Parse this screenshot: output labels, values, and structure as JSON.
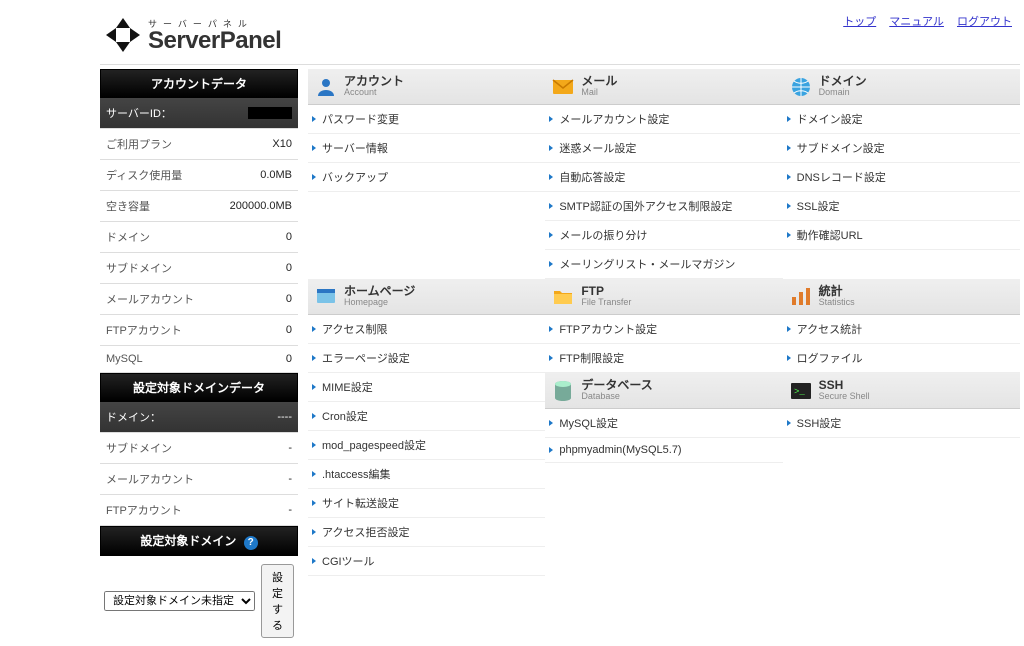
{
  "header": {
    "kana": "サーバーパネル",
    "title": "ServerPanel",
    "links": {
      "top": "トップ",
      "manual": "マニュアル",
      "logout": "ログアウト"
    }
  },
  "sidebar": {
    "accountTitle": "アカウントデータ",
    "serverIdLabel": "サーバーID：",
    "plan": {
      "label": "ご利用プラン",
      "value": "X10"
    },
    "disk": {
      "label": "ディスク使用量",
      "value": "0.0MB"
    },
    "free": {
      "label": "空き容量",
      "value": "200000.0MB"
    },
    "domainCnt": {
      "label": "ドメイン",
      "value": "0"
    },
    "subCnt": {
      "label": "サブドメイン",
      "value": "0"
    },
    "mailCnt": {
      "label": "メールアカウント",
      "value": "0"
    },
    "ftpCnt": {
      "label": "FTPアカウント",
      "value": "0"
    },
    "mysqlCnt": {
      "label": "MySQL",
      "value": "0"
    },
    "targetTitle": "設定対象ドメインデータ",
    "targetDomain": {
      "label": "ドメイン：",
      "value": "----"
    },
    "tSub": {
      "label": "サブドメイン",
      "value": "-"
    },
    "tMail": {
      "label": "メールアカウント",
      "value": "-"
    },
    "tFtp": {
      "label": "FTPアカウント",
      "value": "-"
    },
    "selectTitle": "設定対象ドメイン",
    "selectOption": "設定対象ドメイン未指定",
    "selectBtn": "設定する"
  },
  "categories": {
    "account": {
      "title": "アカウント",
      "sub": "Account",
      "items": [
        "パスワード変更",
        "サーバー情報",
        "バックアップ"
      ]
    },
    "mail": {
      "title": "メール",
      "sub": "Mail",
      "items": [
        "メールアカウント設定",
        "迷惑メール設定",
        "自動応答設定",
        "SMTP認証の国外アクセス制限設定",
        "メールの振り分け",
        "メーリングリスト・メールマガジン"
      ]
    },
    "domain": {
      "title": "ドメイン",
      "sub": "Domain",
      "items": [
        "ドメイン設定",
        "サブドメイン設定",
        "DNSレコード設定",
        "SSL設定",
        "動作確認URL"
      ]
    },
    "homepage": {
      "title": "ホームページ",
      "sub": "Homepage",
      "items": [
        "アクセス制限",
        "エラーページ設定",
        "MIME設定",
        "Cron設定",
        "mod_pagespeed設定",
        ".htaccess編集",
        "サイト転送設定",
        "アクセス拒否設定",
        "CGIツール"
      ]
    },
    "ftp": {
      "title": "FTP",
      "sub": "File Transfer",
      "items": [
        "FTPアカウント設定",
        "FTP制限設定"
      ]
    },
    "stats": {
      "title": "統計",
      "sub": "Statistics",
      "items": [
        "アクセス統計",
        "ログファイル"
      ]
    },
    "db": {
      "title": "データベース",
      "sub": "Database",
      "items": [
        "MySQL設定",
        "phpmyadmin(MySQL5.7)"
      ]
    },
    "ssh": {
      "title": "SSH",
      "sub": "Secure Shell",
      "items": [
        "SSH設定"
      ]
    }
  }
}
